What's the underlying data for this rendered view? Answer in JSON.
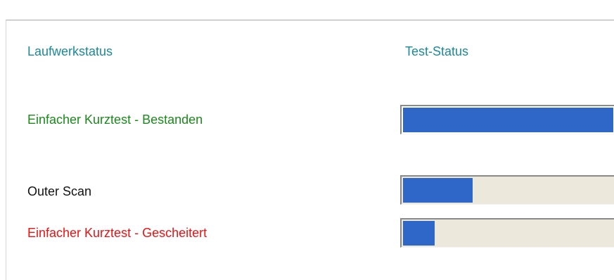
{
  "headers": {
    "drive_status": "Laufwerkstatus",
    "test_status": "Test-Status"
  },
  "rows": [
    {
      "label": "Einfacher Kurztest - Bestanden",
      "progress": 1.0,
      "color": "#1a8a1a"
    },
    {
      "label": "Outer Scan",
      "progress": 0.33,
      "color": "#111111"
    },
    {
      "label": "Einfacher Kurztest - Gescheitert",
      "progress": 0.15,
      "color": "#ee1111"
    }
  ],
  "colors": {
    "header": "#1a8a9a",
    "bar_fill": "#2f67c9",
    "bar_track": "#ece8dc"
  }
}
